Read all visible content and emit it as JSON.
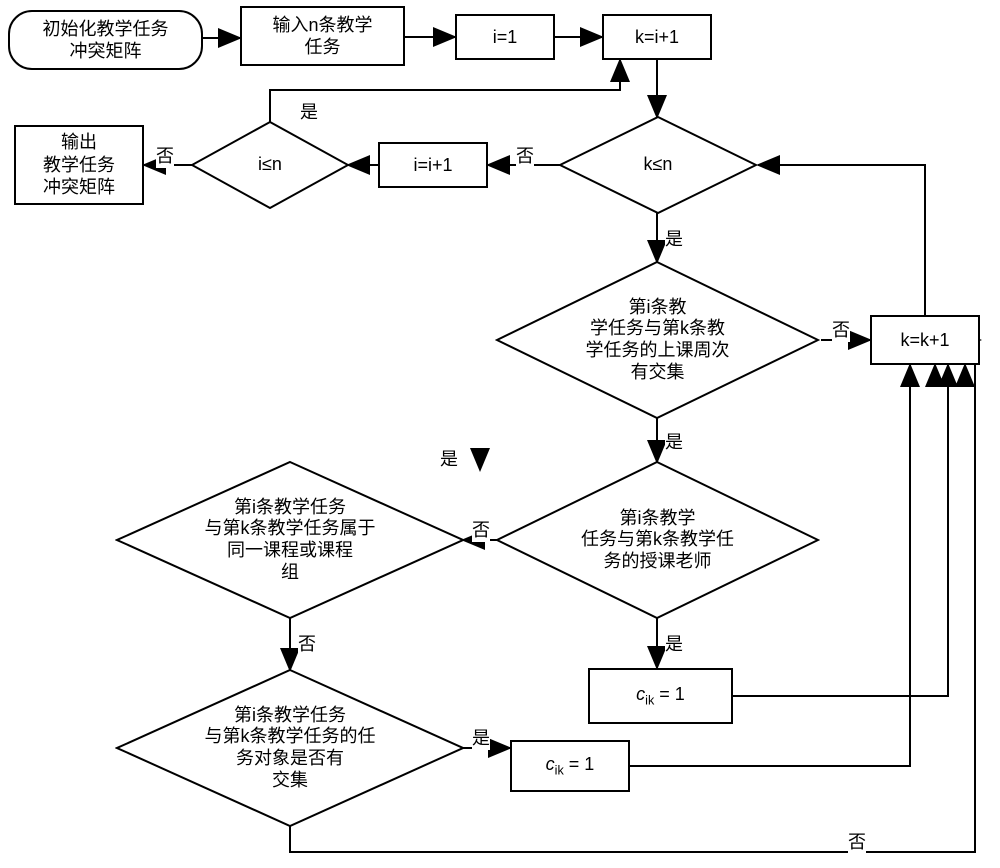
{
  "nodes": {
    "start": "初始化教学任务\n冲突矩阵",
    "input_n": "输入n条教学\n任务",
    "set_i1": "i=1",
    "set_k": "k=i+1",
    "cond_kn": "k≤n",
    "inc_i": "i=i+1",
    "cond_in": "i≤n",
    "output": "输出\n教学任务\n冲突矩阵",
    "cond_week": "第i条教\n学任务与第k条教\n学任务的上课周次\n有交集",
    "inc_k": "k=k+1",
    "cond_teacher": "第i条教学\n任务与第k条教学任\n务的授课老师",
    "cond_course": "第i条教学任务\n与第k条教学任务属于\n同一课程或课程\n组",
    "set_c1_a": "c_ik = 1",
    "cond_object": "第i条教学任务\n与第k条教学任务的任\n务对象是否有\n交集",
    "set_c1_b": "c_ik = 1"
  },
  "labels": {
    "yes": "是",
    "no": "否"
  },
  "chart_data": {
    "type": "flowchart",
    "description": "Algorithm to build a teaching-task conflict matrix",
    "nodes": [
      {
        "id": "start",
        "type": "terminator",
        "label": "初始化教学任务冲突矩阵"
      },
      {
        "id": "input_n",
        "type": "process",
        "label": "输入n条教学任务"
      },
      {
        "id": "set_i1",
        "type": "process",
        "label": "i=1"
      },
      {
        "id": "set_k",
        "type": "process",
        "label": "k=i+1"
      },
      {
        "id": "cond_kn",
        "type": "decision",
        "label": "k≤n"
      },
      {
        "id": "inc_i",
        "type": "process",
        "label": "i=i+1"
      },
      {
        "id": "cond_in",
        "type": "decision",
        "label": "i≤n"
      },
      {
        "id": "output",
        "type": "process",
        "label": "输出教学任务冲突矩阵"
      },
      {
        "id": "cond_week",
        "type": "decision",
        "label": "第i条教学任务与第k条教学任务的上课周次有交集"
      },
      {
        "id": "inc_k",
        "type": "process",
        "label": "k=k+1"
      },
      {
        "id": "cond_teacher",
        "type": "decision",
        "label": "第i条教学任务与第k条教学任务的授课老师"
      },
      {
        "id": "cond_course",
        "type": "decision",
        "label": "第i条教学任务与第k条教学任务属于同一课程或课程组"
      },
      {
        "id": "set_c1_a",
        "type": "process",
        "label": "c_ik = 1"
      },
      {
        "id": "cond_object",
        "type": "decision",
        "label": "第i条教学任务与第k条教学任务的任务对象是否有交集"
      },
      {
        "id": "set_c1_b",
        "type": "process",
        "label": "c_ik = 1"
      }
    ],
    "edges": [
      {
        "from": "start",
        "to": "input_n"
      },
      {
        "from": "input_n",
        "to": "set_i1"
      },
      {
        "from": "set_i1",
        "to": "set_k"
      },
      {
        "from": "set_k",
        "to": "cond_kn"
      },
      {
        "from": "cond_kn",
        "to": "cond_week",
        "label": "是"
      },
      {
        "from": "cond_kn",
        "to": "inc_i",
        "label": "否"
      },
      {
        "from": "inc_i",
        "to": "cond_in"
      },
      {
        "from": "cond_in",
        "to": "set_k",
        "label": "是"
      },
      {
        "from": "cond_in",
        "to": "output",
        "label": "否"
      },
      {
        "from": "cond_week",
        "to": "cond_teacher",
        "label": "是"
      },
      {
        "from": "cond_week",
        "to": "inc_k",
        "label": "否"
      },
      {
        "from": "cond_teacher",
        "to": "set_c1_a",
        "label": "是"
      },
      {
        "from": "cond_teacher",
        "to": "cond_course",
        "label": "否"
      },
      {
        "from": "set_c1_a",
        "to": "inc_k"
      },
      {
        "from": "cond_course",
        "to": "inc_k",
        "label": "是"
      },
      {
        "from": "cond_course",
        "to": "cond_object",
        "label": "否"
      },
      {
        "from": "cond_object",
        "to": "set_c1_b",
        "label": "是"
      },
      {
        "from": "cond_object",
        "to": "inc_k",
        "label": "否"
      },
      {
        "from": "set_c1_b",
        "to": "inc_k"
      },
      {
        "from": "inc_k",
        "to": "cond_kn"
      }
    ]
  }
}
